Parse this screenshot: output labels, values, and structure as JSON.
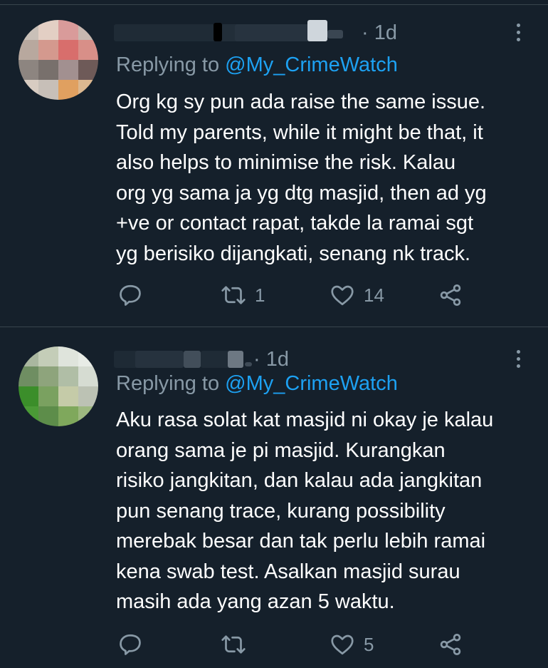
{
  "tweets": [
    {
      "time": "· 1d",
      "reply_prefix": "Replying to",
      "reply_handle": "@My_CrimeWatch",
      "lines": [
        "Org kg sy pun ada raise the same issue.",
        "Told my parents, while it might be that, it",
        "also helps to minimise the risk. Kalau",
        "org yg sama ja yg dtg masjid, then ad yg",
        "+ve or contact rapat, takde la ramai sgt",
        "yg berisiko dijangkati, senang nk track."
      ],
      "retweets": "1",
      "likes": "14"
    },
    {
      "time": "· 1d",
      "reply_prefix": "Replying to",
      "reply_handle": "@My_CrimeWatch",
      "lines": [
        "Aku rasa solat kat masjid ni okay je kalau",
        "orang sama je pi masjid. Kurangkan",
        "risiko jangkitan, dan kalau ada jangkitan",
        "pun senang trace, kurang possibility",
        "merebak besar dan tak perlu lebih ramai",
        "kena swab test. Asalkan masjid surau",
        "masih ada yang azan 5 waktu."
      ],
      "retweets": "",
      "likes": "5"
    }
  ],
  "icons": {
    "reply": "reply-icon",
    "retweet": "retweet-icon",
    "like": "heart-icon",
    "share": "share-icon",
    "more": "more-icon"
  },
  "colors": {
    "background": "#15202b",
    "secondary_text": "#8899a6",
    "link": "#1da1f2",
    "divider": "#38444d"
  }
}
